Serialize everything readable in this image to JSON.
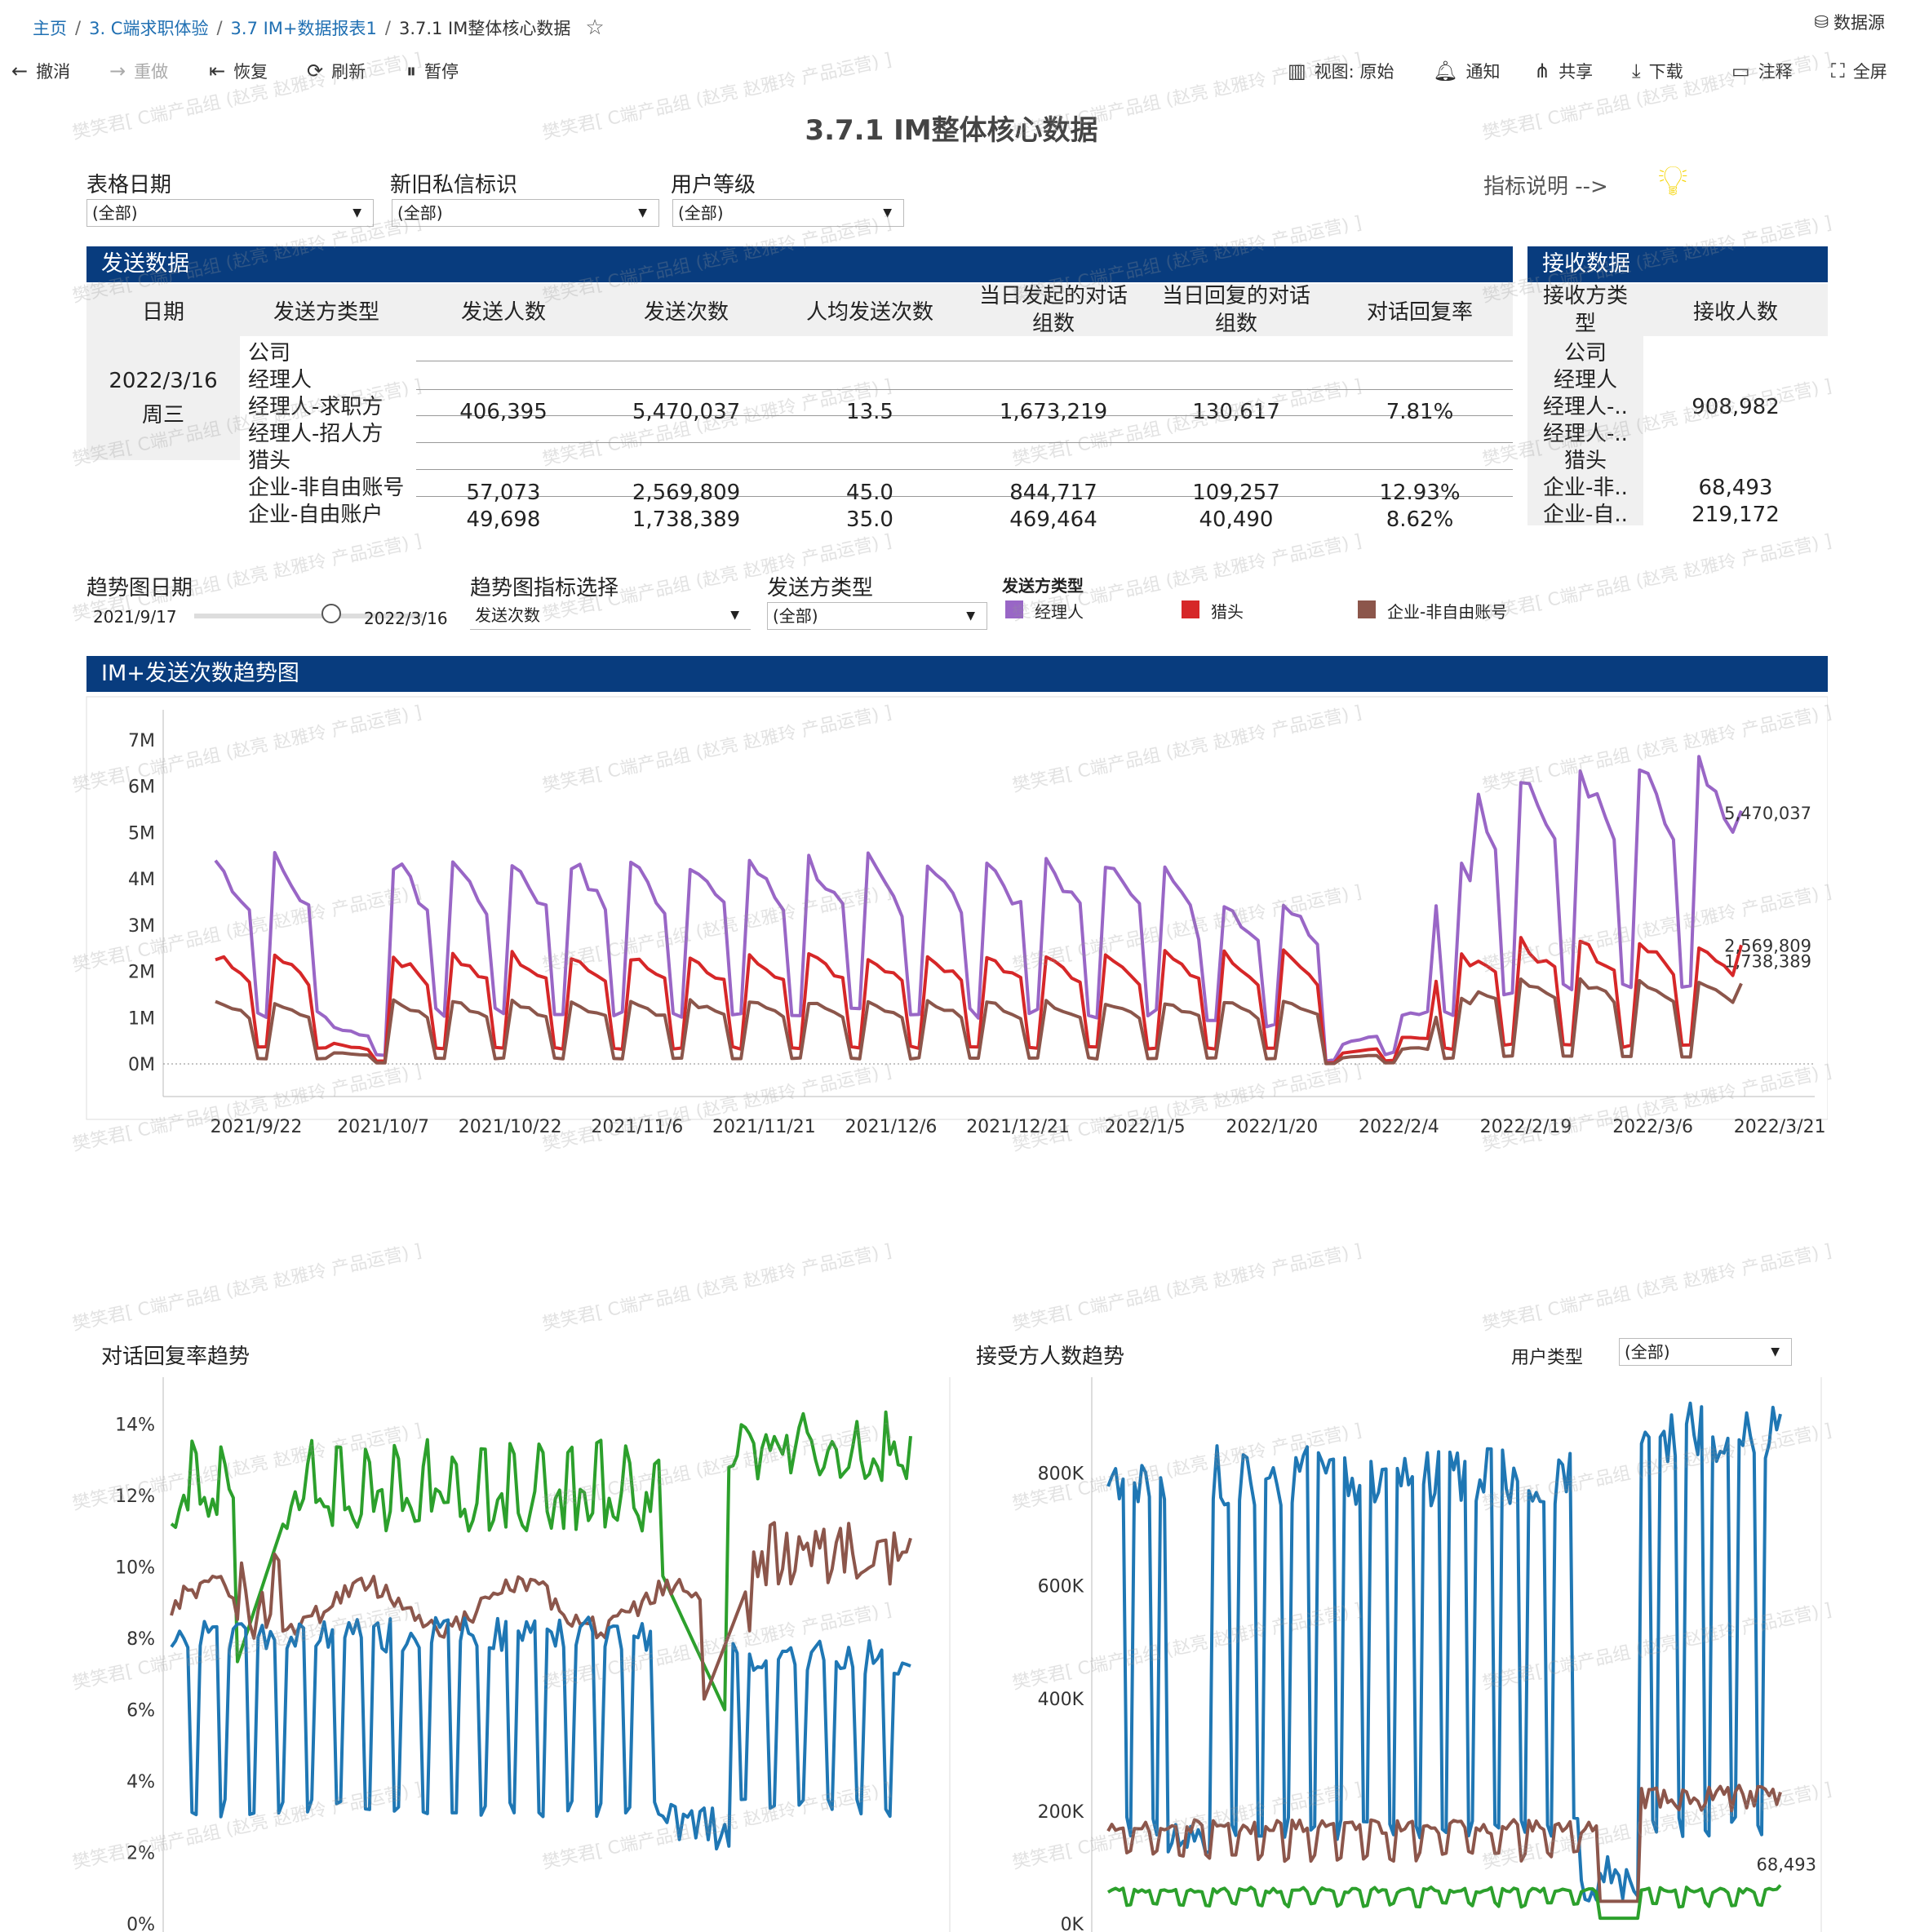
{
  "breadcrumb": [
    "主页",
    "3. C端求职体验",
    "3.7 IM+数据报表1",
    "3.7.1 IM整体核心数据"
  ],
  "datasource_label": "数据源",
  "toolbar": {
    "undo": "撤消",
    "redo": "重做",
    "revert": "恢复",
    "refresh": "刷新",
    "pause": "暂停",
    "view": "视图: 原始",
    "notify": "通知",
    "share": "共享",
    "download": "下载",
    "comment": "注释",
    "fullscreen": "全屏"
  },
  "dashboard_title": "3.7.1 IM整体核心数据",
  "filters": {
    "date": {
      "label": "表格日期",
      "value": "(全部)"
    },
    "flag": {
      "label": "新旧私信标识",
      "value": "(全部)"
    },
    "level": {
      "label": "用户等级",
      "value": "(全部)"
    },
    "metric_note": "指标说明 -->"
  },
  "send_section": {
    "title": "发送数据",
    "headers": [
      "日期",
      "发送方类型",
      "发送人数",
      "发送次数",
      "人均发送次数",
      "当日发起的对话组数",
      "当日回复的对话组数",
      "对话回复率"
    ],
    "date": "2022/3/16",
    "weekday": "周三",
    "sender_types": [
      "公司",
      "经理人",
      "经理人-求职方",
      "经理人-招人方",
      "猎头",
      "企业-非自由账号",
      "企业-自由账户"
    ],
    "rows": [
      [
        "406,395",
        "5,470,037",
        "13.5",
        "1,673,219",
        "130,617",
        "7.81%"
      ],
      [
        "57,073",
        "2,569,809",
        "45.0",
        "844,717",
        "109,257",
        "12.93%"
      ],
      [
        "49,698",
        "1,738,389",
        "35.0",
        "469,464",
        "40,490",
        "8.62%"
      ]
    ]
  },
  "recv_section": {
    "title": "接收数据",
    "headers": [
      "接收方类型",
      "接收人数"
    ],
    "types": [
      "公司",
      "经理人",
      "经理人-..",
      "经理人-..",
      "猎头",
      "企业-非..",
      "企业-自.."
    ],
    "values": [
      "908,982",
      "68,493",
      "219,172"
    ]
  },
  "trend_filters": {
    "date_label": "趋势图日期",
    "date_start": "2021/9/17",
    "date_end": "2022/3/16",
    "metric_label": "趋势图指标选择",
    "metric_value": "发送次数",
    "sender_label": "发送方类型",
    "sender_value": "(全部)",
    "legend_title": "发送方类型",
    "legend": [
      {
        "name": "经理人",
        "color": "#9966c6"
      },
      {
        "name": "猎头",
        "color": "#d62728"
      },
      {
        "name": "企业-非自由账号",
        "color": "#8c564b"
      }
    ]
  },
  "main_chart_title": "IM+发送次数趋势图",
  "chart_data": [
    {
      "type": "line",
      "title": "IM+发送次数趋势图",
      "x_ticks": [
        "2021/9/22",
        "2021/10/7",
        "2021/10/22",
        "2021/11/6",
        "2021/11/21",
        "2021/12/6",
        "2021/12/21",
        "2022/1/5",
        "2022/1/20",
        "2022/2/4",
        "2022/2/19",
        "2022/3/6",
        "2022/3/21"
      ],
      "y_ticks": [
        "0M",
        "1M",
        "2M",
        "3M",
        "4M",
        "5M",
        "6M",
        "7M"
      ],
      "ylim": [
        0,
        7300000
      ],
      "end_labels": [
        "5,470,037",
        "2,569,809",
        "1,738,389"
      ],
      "series": [
        {
          "name": "经理人",
          "color": "#9966c6",
          "last": 5470037
        },
        {
          "name": "猎头",
          "color": "#d62728",
          "last": 2569809
        },
        {
          "name": "企业-非自由账号",
          "color": "#8c564b",
          "last": 1738389
        }
      ]
    },
    {
      "type": "line",
      "title": "对话回复率趋势",
      "y_ticks": [
        "0%",
        "2%",
        "4%",
        "6%",
        "8%",
        "10%",
        "12%",
        "14%"
      ],
      "ylim": [
        0,
        15
      ],
      "series": [
        {
          "color": "#2ca02c"
        },
        {
          "color": "#8c564b"
        },
        {
          "color": "#1f77b4"
        }
      ]
    },
    {
      "type": "line",
      "title": "接受方人数趋势",
      "y_ticks": [
        "0K",
        "200K",
        "400K",
        "600K",
        "800K"
      ],
      "ylim": [
        0,
        950000
      ],
      "end_labels": [
        "68,493"
      ],
      "series": [
        {
          "color": "#1f77b4"
        },
        {
          "color": "#8c564b"
        },
        {
          "color": "#2ca02c",
          "last": 68493
        }
      ]
    }
  ],
  "reply_title": "对话回复率趋势",
  "recv_title": "接受方人数趋势",
  "user_type": {
    "label": "用户类型",
    "value": "(全部)"
  },
  "watermark": "樊笑君[ C端产品组 (赵亮 赵雅玲 产品运营) ]"
}
